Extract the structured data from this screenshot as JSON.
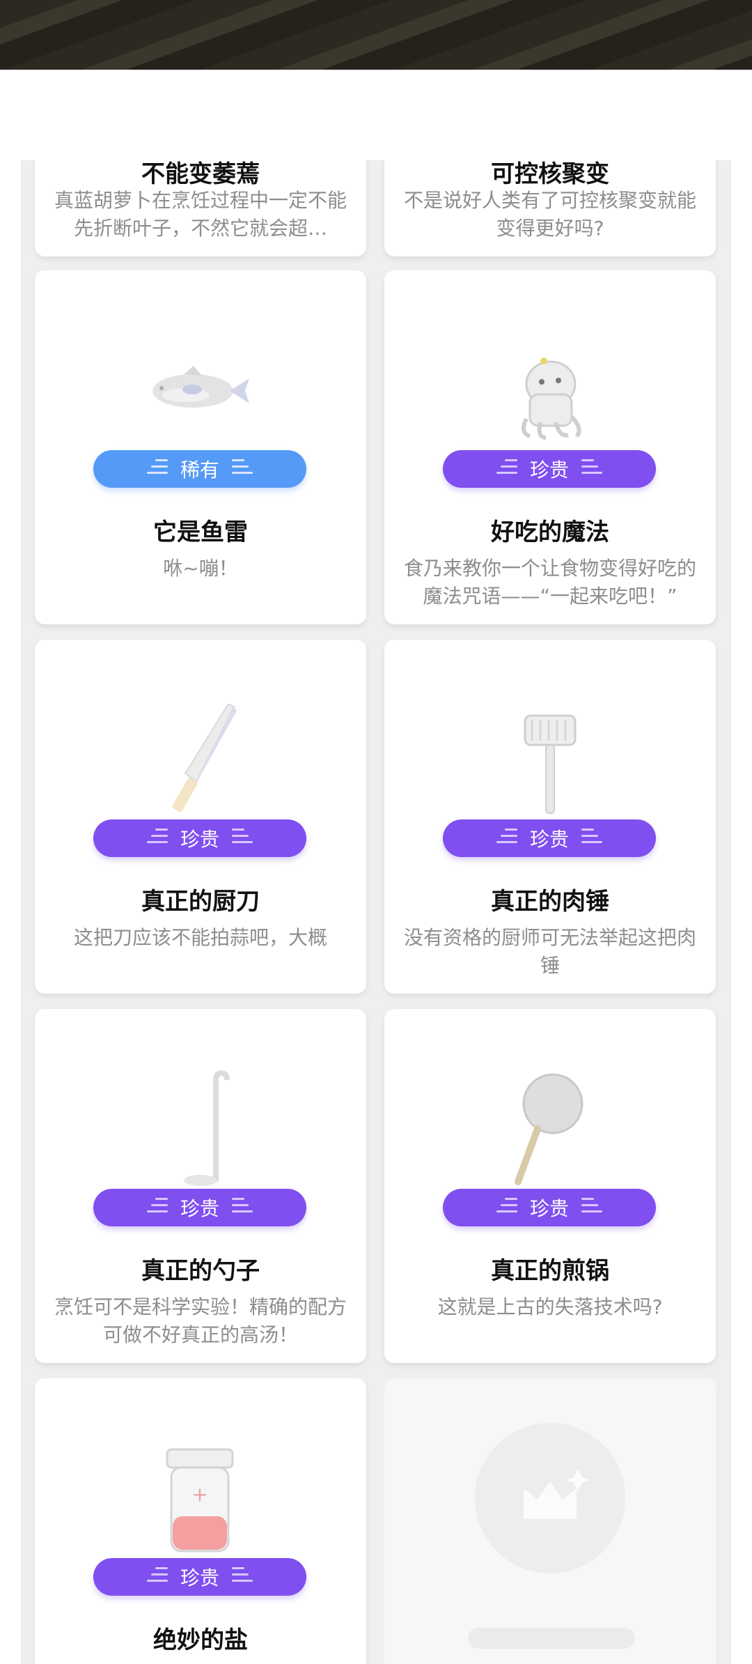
{
  "close_icon": "close-icon",
  "top_partial": [
    {
      "title": "不能变萎蔫",
      "desc": "真蓝胡萝卜在烹饪过程中一定不能先折断叶子，不然它就会超…"
    },
    {
      "title": "可控核聚变",
      "desc": "不是说好人类有了可控核聚变就能变得更好吗?"
    }
  ],
  "cards": [
    {
      "title": "它是鱼雷",
      "desc": "咻~嘣！",
      "badge": "稀有",
      "rarity": "rare",
      "icon": "fish-icon"
    },
    {
      "title": "好吃的魔法",
      "desc": "食乃来教你一个让食物变得好吃的魔法咒语——“一起来吃吧！”",
      "badge": "珍贵",
      "rarity": "precious",
      "icon": "ghost-monster-icon"
    },
    {
      "title": "真正的厨刀",
      "desc": "这把刀应该不能拍蒜吧，大概",
      "badge": "珍贵",
      "rarity": "precious",
      "icon": "knife-icon"
    },
    {
      "title": "真正的肉锤",
      "desc": "没有资格的厨师可无法举起这把肉锤",
      "badge": "珍贵",
      "rarity": "precious",
      "icon": "meat-hammer-icon"
    },
    {
      "title": "真正的勺子",
      "desc": "烹饪可不是科学实验！精确的配方可做不好真正的高汤！",
      "badge": "珍贵",
      "rarity": "precious",
      "icon": "ladle-icon"
    },
    {
      "title": "真正的煎锅",
      "desc": "这就是上古的失落技术吗?",
      "badge": "珍贵",
      "rarity": "precious",
      "icon": "frying-pan-icon"
    },
    {
      "title": "绝妙的盐",
      "desc": "",
      "badge": "珍贵",
      "rarity": "precious",
      "icon": "salt-jar-icon"
    }
  ],
  "colors": {
    "rare": "#569af7",
    "precious": "#7f4ff0"
  }
}
